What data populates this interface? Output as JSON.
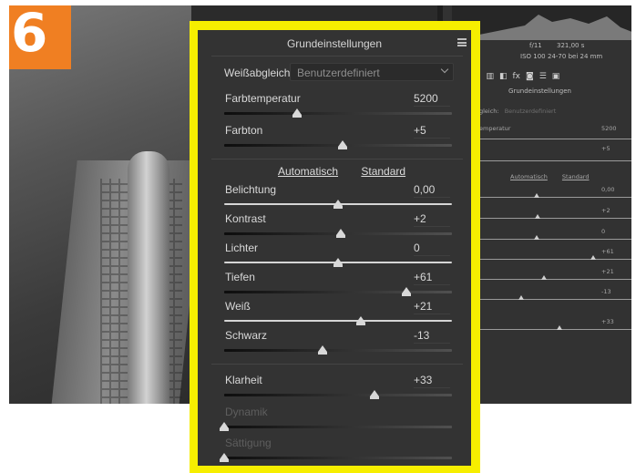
{
  "badge": {
    "number": "6",
    "color": "#f07f22"
  },
  "frame_color": "#f6ee00",
  "camera_info": {
    "aperture": "f/11",
    "shutter": "321,00 s",
    "iso": "ISO 100",
    "lens": "24-70 bei 24 mm"
  },
  "right_panel": {
    "title": "Grundeinstellungen",
    "wb_label": "gleich:",
    "wb_value": "Benutzerdefiniert",
    "temp_label": "emperatur",
    "temp_value": "5200",
    "tint_value": "+5",
    "link_auto": "Automatisch",
    "link_std": "Standard",
    "values": [
      "0,00",
      "+2",
      "0",
      "+61",
      "+21",
      "-13",
      "+33"
    ]
  },
  "panel": {
    "title": "Grundeinstellungen",
    "white_balance": {
      "label": "Weißabgleich:",
      "selected": "Benutzerdefiniert"
    },
    "links": {
      "auto": "Automatisch",
      "default": "Standard"
    },
    "sliders": [
      {
        "label": "Farbtemperatur",
        "value": "5200",
        "position": 0.32,
        "enabled": true
      },
      {
        "label": "Farbton",
        "value": "+5",
        "position": 0.52,
        "enabled": true
      },
      {
        "label": "Belichtung",
        "value": "0,00",
        "position": 0.5,
        "enabled": true
      },
      {
        "label": "Kontrast",
        "value": "+2",
        "position": 0.51,
        "enabled": true
      },
      {
        "label": "Lichter",
        "value": "0",
        "position": 0.5,
        "enabled": true
      },
      {
        "label": "Tiefen",
        "value": "+61",
        "position": 0.8,
        "enabled": true
      },
      {
        "label": "Weiß",
        "value": "+21",
        "position": 0.6,
        "enabled": true
      },
      {
        "label": "Schwarz",
        "value": "-13",
        "position": 0.43,
        "enabled": true
      },
      {
        "label": "Klarheit",
        "value": "+33",
        "position": 0.66,
        "enabled": true
      },
      {
        "label": "Dynamik",
        "value": "",
        "position": 0.0,
        "enabled": false
      },
      {
        "label": "Sättigung",
        "value": "",
        "position": 0.0,
        "enabled": false
      }
    ]
  }
}
